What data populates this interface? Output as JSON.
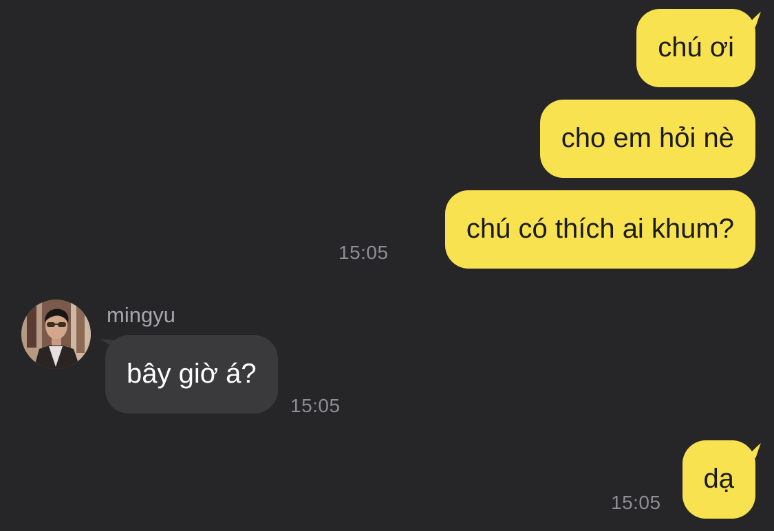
{
  "colors": {
    "background": "#262628",
    "outgoing_bubble": "#f8e24f",
    "incoming_bubble": "#3a3a3c",
    "timestamp": "#8e8e93"
  },
  "messages": [
    {
      "direction": "outgoing",
      "text": "chú ơi"
    },
    {
      "direction": "outgoing",
      "text": "cho em hỏi nè"
    },
    {
      "direction": "outgoing",
      "text": "chú có thích ai khum?",
      "time": "15:05"
    },
    {
      "direction": "incoming",
      "sender": "mingyu",
      "avatar_icon": "user-photo-avatar",
      "text": "bây giờ á?",
      "time": "15:05"
    },
    {
      "direction": "outgoing",
      "text": "dạ",
      "time": "15:05"
    }
  ]
}
